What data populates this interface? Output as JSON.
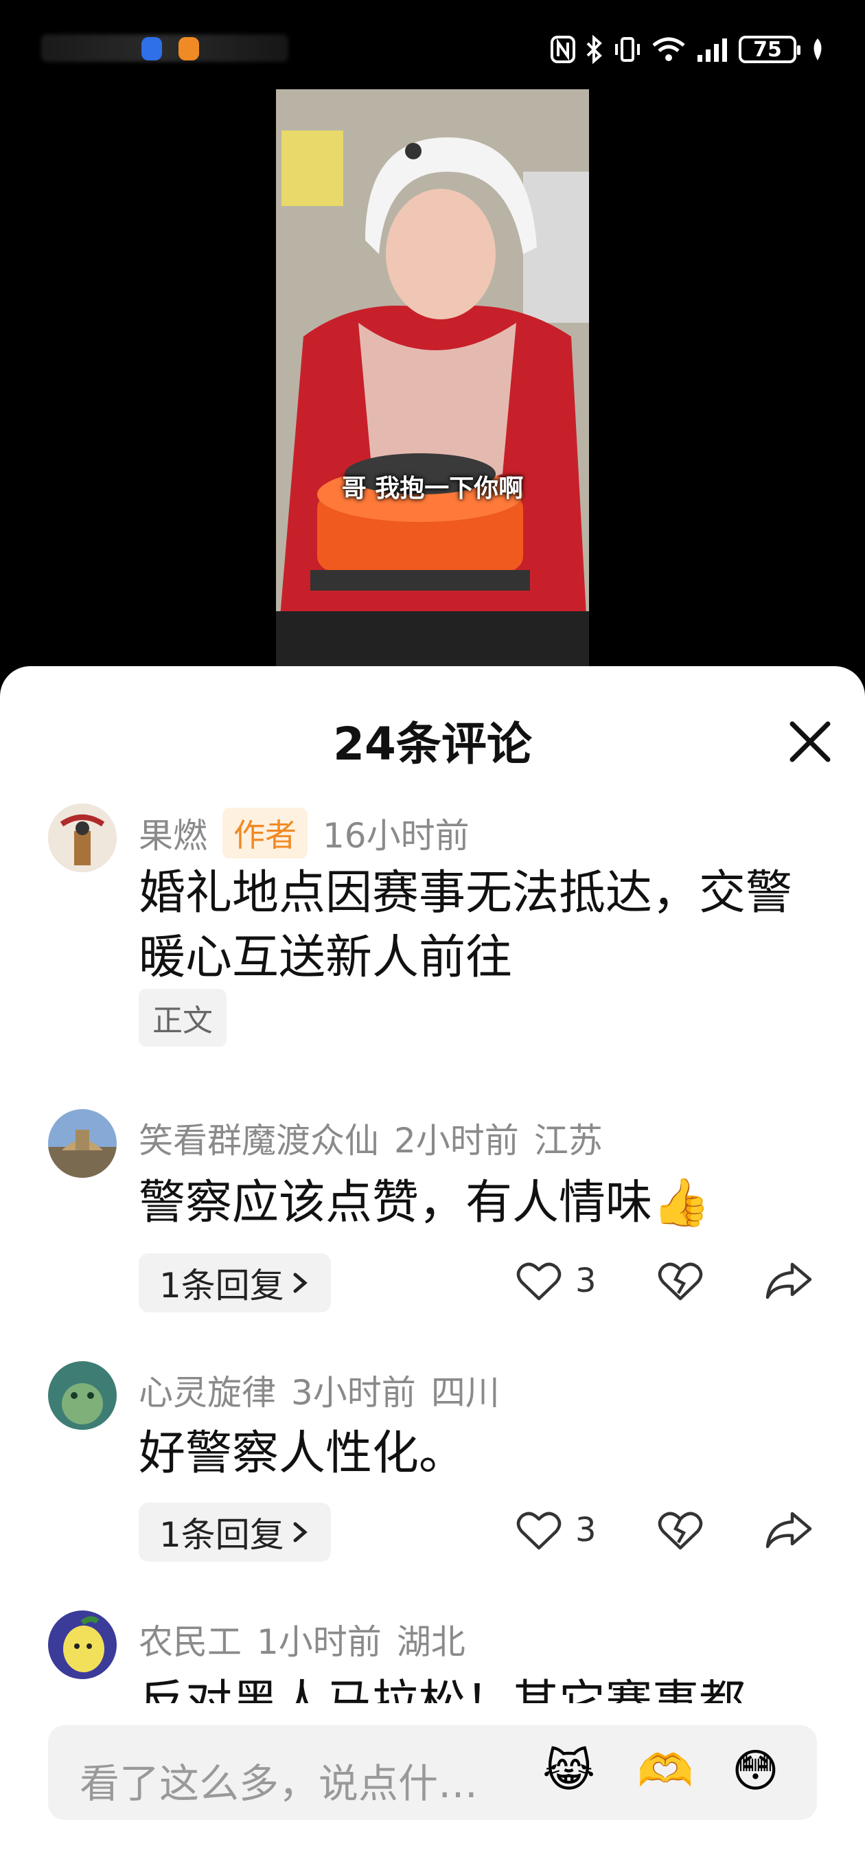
{
  "status_bar": {
    "battery": "75",
    "icons": [
      "nfc-icon",
      "bluetooth-icon",
      "vibrate-icon",
      "wifi-icon",
      "signal-icon",
      "battery-icon",
      "leaf-icon"
    ]
  },
  "video": {
    "subtitle": "哥  我抱一下你啊"
  },
  "comments_panel": {
    "title": "24条评论",
    "comments": [
      {
        "user": "果燃",
        "author_tag": "作者",
        "time": "16小时前",
        "location": "",
        "text": "婚礼地点因赛事无法抵达，交警暖心互送新人前往",
        "tag": "正文"
      },
      {
        "user": "笑看群魔渡众仙",
        "time": "2小时前",
        "location": "江苏",
        "text": "警察应该点赞，有人情味👍",
        "reply_label": "1条回复",
        "likes": "3"
      },
      {
        "user": "心灵旋律",
        "time": "3小时前",
        "location": "四川",
        "text": "好警察人性化。",
        "reply_label": "1条回复",
        "likes": "3"
      },
      {
        "user": "农民工",
        "time": "1小时前",
        "location": "湖北",
        "text": "反对黑人马拉松！其它赛事都"
      }
    ]
  },
  "input": {
    "placeholder": "看了这么多，说点什…",
    "emojis": [
      "😹",
      "🫶",
      "😳"
    ]
  },
  "colors": {
    "author_tag_bg": "#fff1e0",
    "author_tag_text": "#f08a24",
    "meta_gray": "#8a8a8a"
  }
}
